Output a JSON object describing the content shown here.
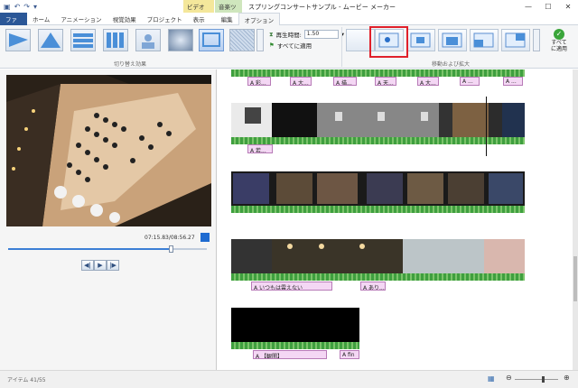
{
  "window": {
    "title": "スプリングコンサートサンプル - ムービー メーカー",
    "video_tools_tab": "ビデオ ツール",
    "audio_tools_tab": "音楽ツール"
  },
  "tabs": [
    "ファイル",
    "ホーム",
    "アニメーション",
    "視覚効果",
    "プロジェクト",
    "表示",
    "編集",
    "オプション"
  ],
  "ribbon": {
    "transitions_group_label": "切り替え効果",
    "pan_zoom_group_label": "移動および拡大",
    "duration_label": "再生時間:",
    "duration_value": "1.50",
    "apply_all_transitions": "すべてに適用",
    "apply_all_pan": "すべて\nに適用"
  },
  "preview": {
    "timestamp": "07:15.83/08:56.27",
    "seek_fraction": 0.82
  },
  "storyboard": {
    "captions_row1": [
      "A 彩...",
      "A 大...",
      "A 描...",
      "A 天...",
      "A 大...",
      "A ...",
      "A ..."
    ],
    "caption_row2": "A 若...",
    "caption_row4_a": "A いつもは雲えない",
    "caption_row4_b": "A あり...",
    "caption_row5_a": "A 【観閲】",
    "caption_row5_b": "A fin"
  },
  "statusbar": {
    "items_text": "アイテム 41/55"
  }
}
